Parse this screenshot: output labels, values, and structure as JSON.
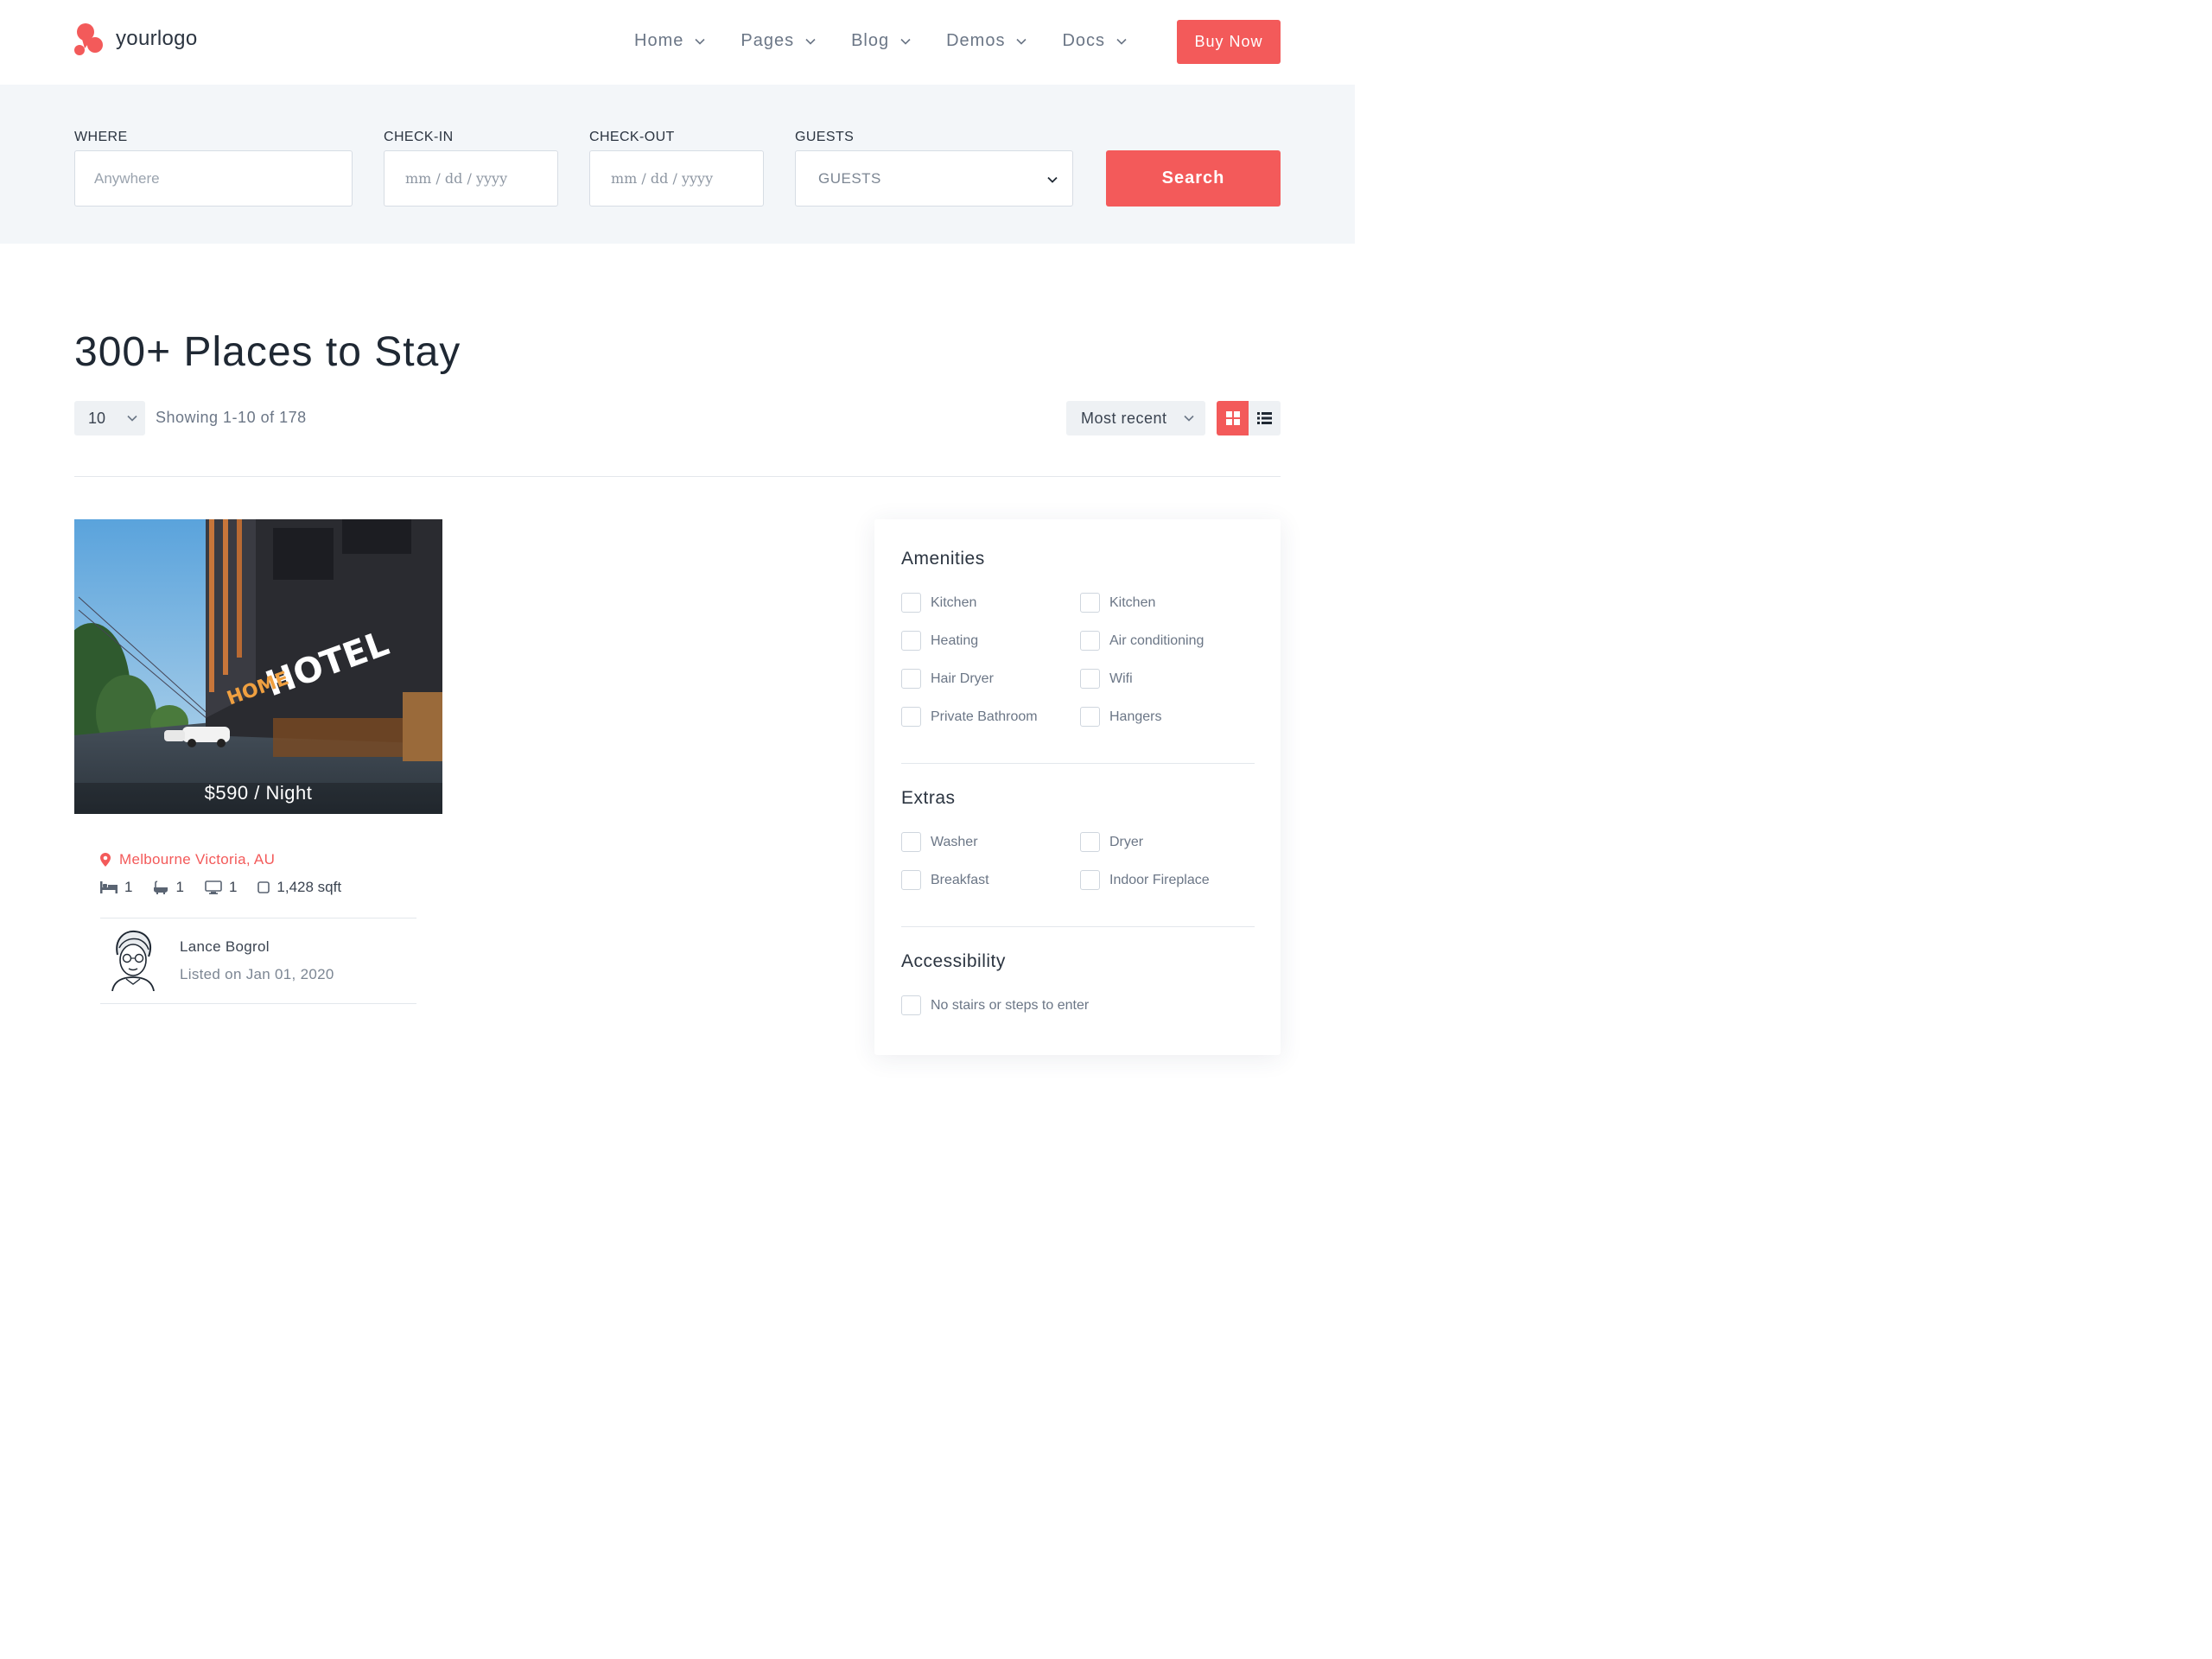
{
  "brand": {
    "name": "yourlogo",
    "accent_color": "#f35a5a"
  },
  "nav": {
    "items": [
      {
        "label": "Home"
      },
      {
        "label": "Pages"
      },
      {
        "label": "Blog"
      },
      {
        "label": "Demos"
      },
      {
        "label": "Docs"
      }
    ],
    "cta_label": "Buy Now"
  },
  "search": {
    "where_label": "WHERE",
    "where_placeholder": "Anywhere",
    "checkin_label": "CHECK-IN",
    "checkin_placeholder": "mm / dd / yyyy",
    "checkout_label": "CHECK-OUT",
    "checkout_placeholder": "mm / dd / yyyy",
    "guests_label": "GUESTS",
    "guests_value": "GUESTS",
    "button_label": "Search"
  },
  "listing_header": {
    "title": "300+ Places to Stay",
    "per_page": "10",
    "showing": "Showing 1-10 of 178",
    "sort": "Most recent",
    "view_mode": "grid"
  },
  "listing": {
    "photo_sign": "THE HOME HOTEL",
    "price": "$590 / Night",
    "location": "Melbourne Victoria, AU",
    "beds": "1",
    "baths": "1",
    "tvs": "1",
    "area": "1,428 sqft",
    "agent_name": "Lance Bogrol",
    "listed_on": "Listed on Jan 01, 2020"
  },
  "filters": {
    "amenities_title": "Amenities",
    "amenities": [
      "Kitchen",
      "Kitchen",
      "Heating",
      "Air conditioning",
      "Hair Dryer",
      "Wifi",
      "Private Bathroom",
      "Hangers"
    ],
    "extras_title": "Extras",
    "extras": [
      "Washer",
      "Dryer",
      "Breakfast",
      "Indoor Fireplace"
    ],
    "accessibility_title": "Accessibility",
    "accessibility": [
      "No stairs or steps to enter"
    ]
  }
}
